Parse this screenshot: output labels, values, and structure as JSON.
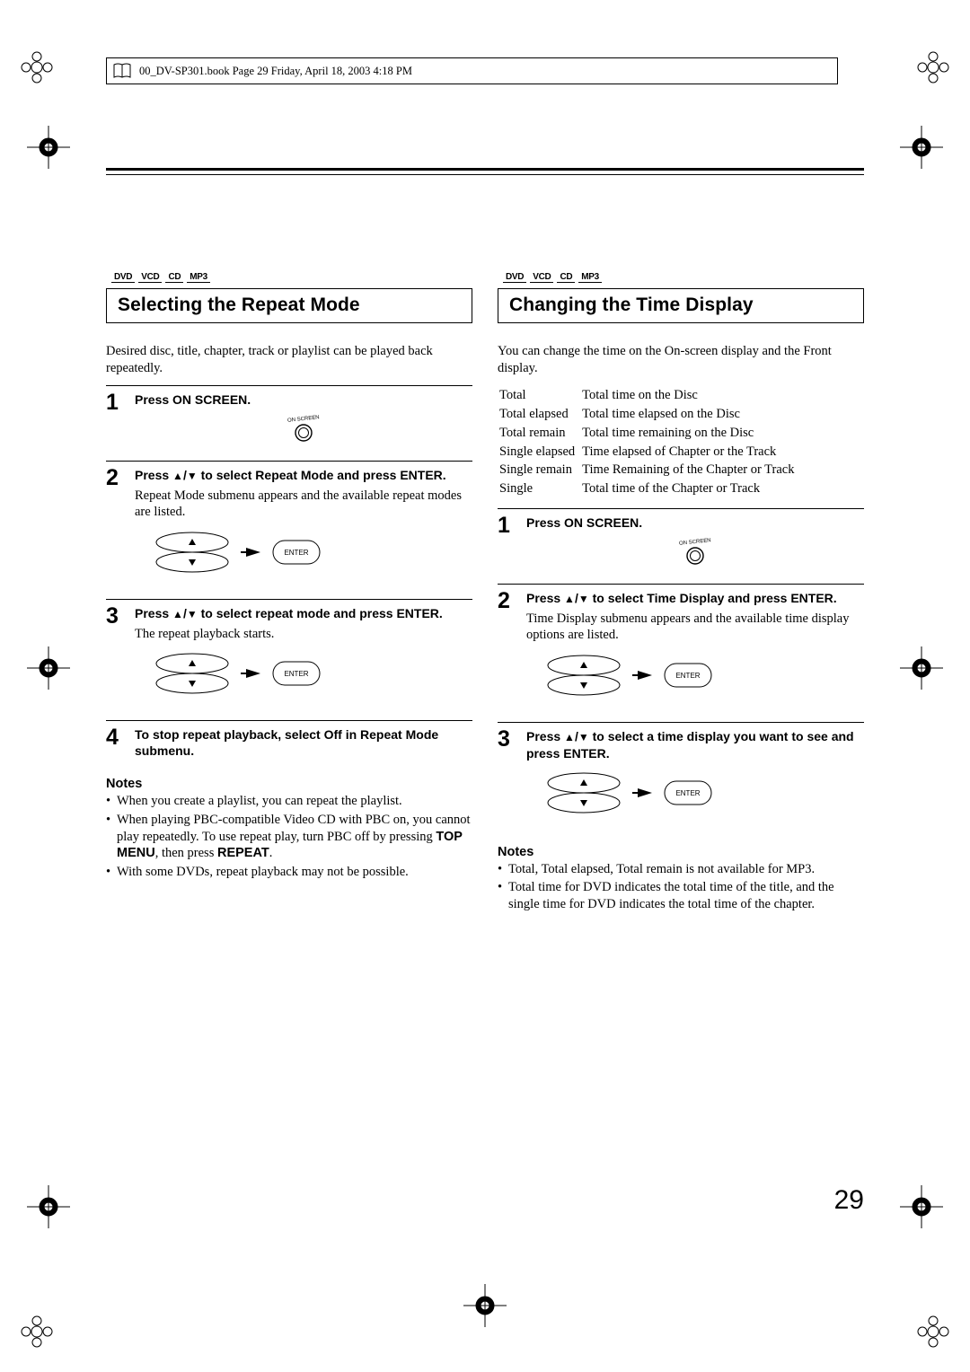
{
  "header": "00_DV-SP301.book  Page 29  Friday, April 18, 2003  4:18 PM",
  "page_number": "29",
  "badges": [
    "DVD",
    "VCD",
    "CD",
    "MP3"
  ],
  "left": {
    "title": "Selecting the Repeat Mode",
    "intro": "Desired disc, title, chapter, track or playlist can be played back repeatedly.",
    "steps": [
      {
        "num": "1",
        "title": "Press ON SCREEN.",
        "text": ""
      },
      {
        "num": "2",
        "title_pre": "Press ",
        "title_mid": " to select Repeat Mode and press ENTER.",
        "text": "Repeat Mode submenu appears and the available repeat modes are listed."
      },
      {
        "num": "3",
        "title_pre": "Press ",
        "title_mid": " to select repeat mode and press ENTER.",
        "text": "The repeat playback starts."
      },
      {
        "num": "4",
        "title": "To stop repeat playback, select Off in Repeat Mode submenu.",
        "text": ""
      }
    ],
    "notes_title": "Notes",
    "notes": [
      "When you create a playlist, you can repeat the playlist.",
      {
        "pre": "When playing PBC-compatible Video CD with PBC on, you cannot play repeatedly. To use repeat play, turn PBC off by pressing ",
        "bold1": "TOP MENU",
        "mid": ", then press ",
        "bold2": "REPEAT",
        "post": "."
      },
      "With some DVDs, repeat playback may not be possible."
    ]
  },
  "right": {
    "title": "Changing the Time Display",
    "intro": "You can change the time on the On-screen display and the Front display.",
    "defs": [
      [
        "Total",
        "Total time on the Disc"
      ],
      [
        "Total elapsed",
        "Total time elapsed on the Disc"
      ],
      [
        "Total remain",
        "Total time remaining on the Disc"
      ],
      [
        "Single elapsed",
        "Time elapsed of Chapter or the Track"
      ],
      [
        "Single remain",
        "Time Remaining of the Chapter or Track"
      ],
      [
        "Single",
        "Total time of the Chapter or Track"
      ]
    ],
    "steps": [
      {
        "num": "1",
        "title": "Press ON SCREEN.",
        "text": ""
      },
      {
        "num": "2",
        "title_pre": "Press ",
        "title_mid": " to select Time Display and press ENTER.",
        "text": "Time Display submenu appears and the available time display options are listed."
      },
      {
        "num": "3",
        "title_pre": "Press ",
        "title_mid": " to select a time display you want to see and press ENTER.",
        "text": ""
      }
    ],
    "notes_title": "Notes",
    "notes": [
      "Total, Total elapsed, Total remain is not available for MP3.",
      "Total time for DVD indicates the total time of the title, and the single time for DVD indicates the total time of the chapter."
    ]
  },
  "icons": {
    "onscreen_label": "ON SCREEN",
    "enter_label": "ENTER"
  }
}
